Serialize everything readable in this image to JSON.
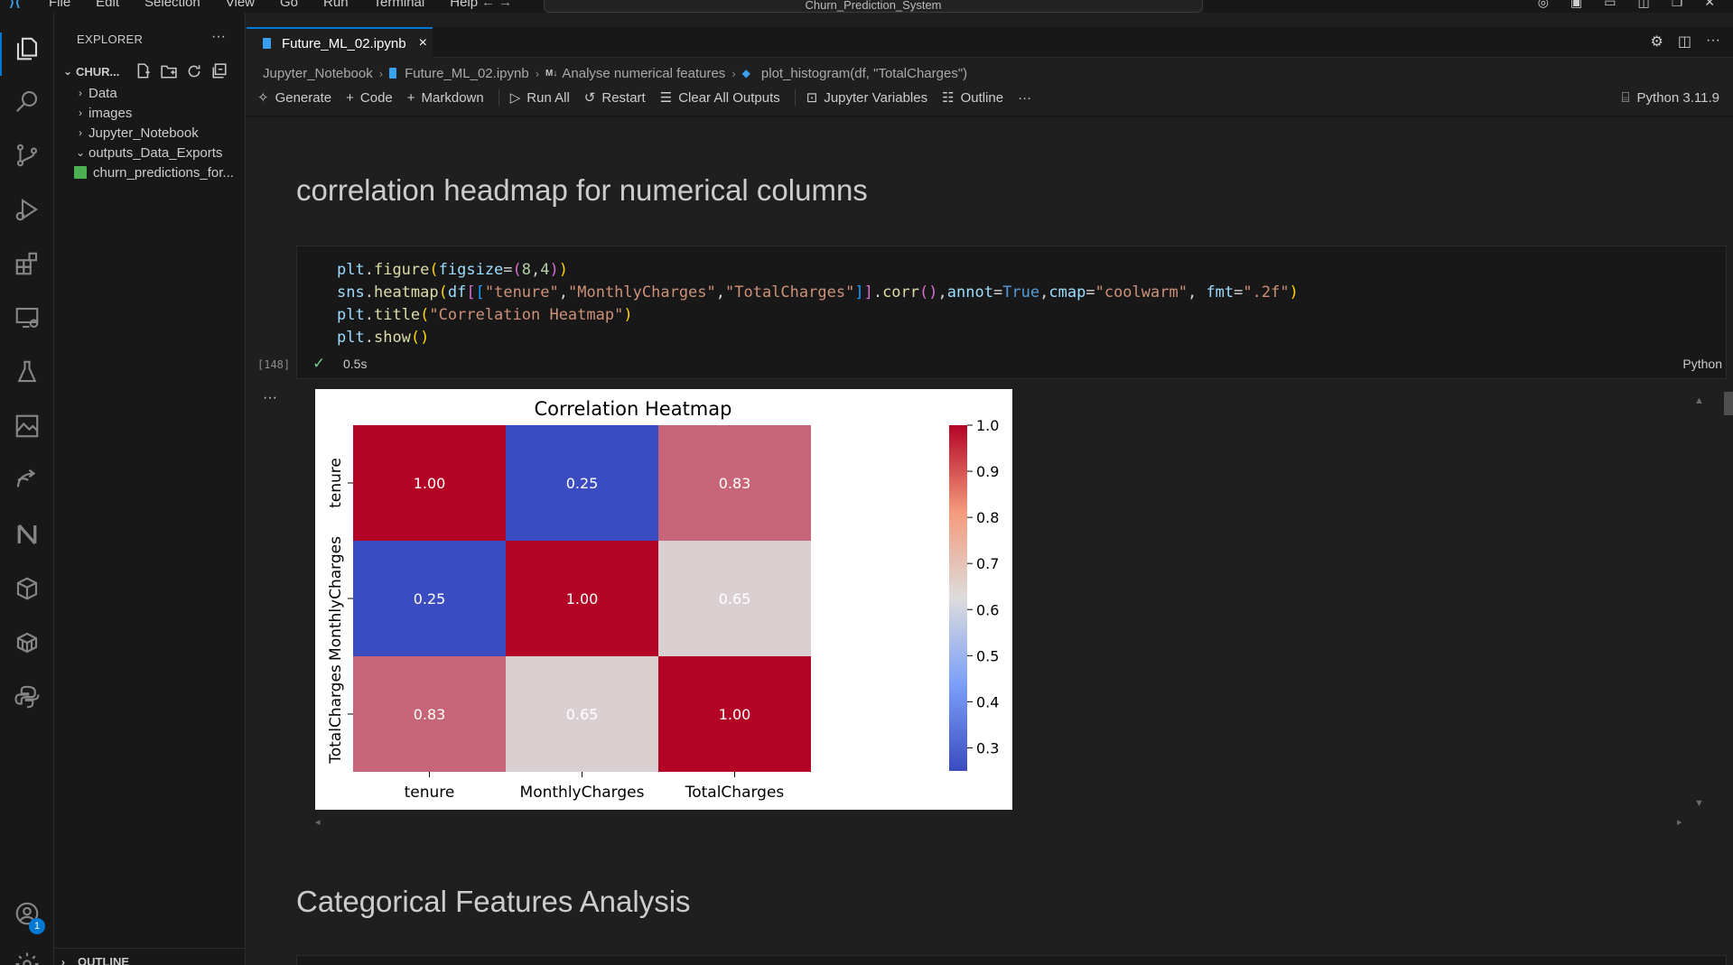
{
  "menu": {
    "logo_icon": "vscode-logo-icon",
    "items": [
      "File",
      "Edit",
      "Selection",
      "View",
      "Go",
      "Run",
      "Terminal",
      "Help"
    ],
    "nav": "←  →",
    "command_center": "Churn_Prediction_System"
  },
  "activity_bar": {
    "icons": [
      "explorer-icon",
      "search-icon",
      "source-control-icon",
      "run-debug-icon",
      "extensions-icon",
      "remote-explorer-icon",
      "testing-icon",
      "image-preview-icon",
      "live-share-icon",
      "notion-icon",
      "package-icon",
      "database-icon",
      "python-icon",
      "accounts-icon",
      "settings-gear-icon"
    ],
    "accounts_badge": "1"
  },
  "sidebar": {
    "title": "EXPLORER",
    "more": "···",
    "root": "CHUR...",
    "items": [
      {
        "label": "Data",
        "chevron": "›"
      },
      {
        "label": "images",
        "chevron": "›"
      },
      {
        "label": "Jupyter_Notebook",
        "chevron": "›"
      },
      {
        "label": "outputs_Data_Exports",
        "chevron": "⌄"
      },
      {
        "label": "churn_predictions_for..."
      }
    ],
    "outline": "OUTLINE"
  },
  "tab": {
    "label": "Future_ML_02.ipynb",
    "close": "×"
  },
  "breadcrumb": {
    "folder": "Jupyter_Notebook",
    "file": "Future_ML_02.ipynb",
    "md_icon": "M↓",
    "section": "Analyse numerical features",
    "symbol": "plot_histogram(df, \"TotalCharges\")"
  },
  "toolbar": {
    "generate": "Generate",
    "code": "Code",
    "markdown": "Markdown",
    "run_all": "Run All",
    "restart": "Restart",
    "clear_all_outputs": "Clear All Outputs",
    "jupyter_variables": "Jupyter Variables",
    "outline": "Outline",
    "more": "···",
    "kernel": "Python 3.11.9"
  },
  "cells": {
    "heading1": "correlation headmap for numerical columns",
    "code_lines": [
      "plt.figure(figsize=(8,4))",
      "sns.heatmap(df[[\"tenure\",\"MonthlyCharges\",\"TotalCharges\"]].corr(),annot=True,cmap=\"coolwarm\", fmt=\".2f\")",
      "plt.title(\"Correlation Heatmap\")",
      "plt.show()"
    ],
    "exec_count": "[148]",
    "check": "✓",
    "exec_time": "0.5s",
    "language": "Python",
    "output_more": "···",
    "heading2": "Categorical Features Analysis"
  },
  "chart_data": {
    "type": "heatmap",
    "title": "Correlation Heatmap",
    "x_categories": [
      "tenure",
      "MonthlyCharges",
      "TotalCharges"
    ],
    "y_categories": [
      "tenure",
      "MonthlyCharges",
      "TotalCharges"
    ],
    "values": [
      [
        1.0,
        0.25,
        0.83
      ],
      [
        0.25,
        1.0,
        0.65
      ],
      [
        0.83,
        0.65,
        1.0
      ]
    ],
    "labels": [
      [
        "1.00",
        "0.25",
        "0.83"
      ],
      [
        "0.25",
        "1.00",
        "0.65"
      ],
      [
        "0.83",
        "0.65",
        "1.00"
      ]
    ],
    "colormap": "coolwarm",
    "colorbar_range": [
      0.25,
      1.0
    ],
    "colorbar_ticks": [
      0.3,
      0.4,
      0.5,
      0.6,
      0.7,
      0.8,
      0.9,
      1.0
    ],
    "colorbar_tick_labels": [
      "0.3",
      "0.4",
      "0.5",
      "0.6",
      "0.7",
      "0.8",
      "0.9",
      "1.0"
    ],
    "colors": {
      "low": "#3b4cc0",
      "mid": "#dddddd",
      "high": "#b40426"
    }
  }
}
